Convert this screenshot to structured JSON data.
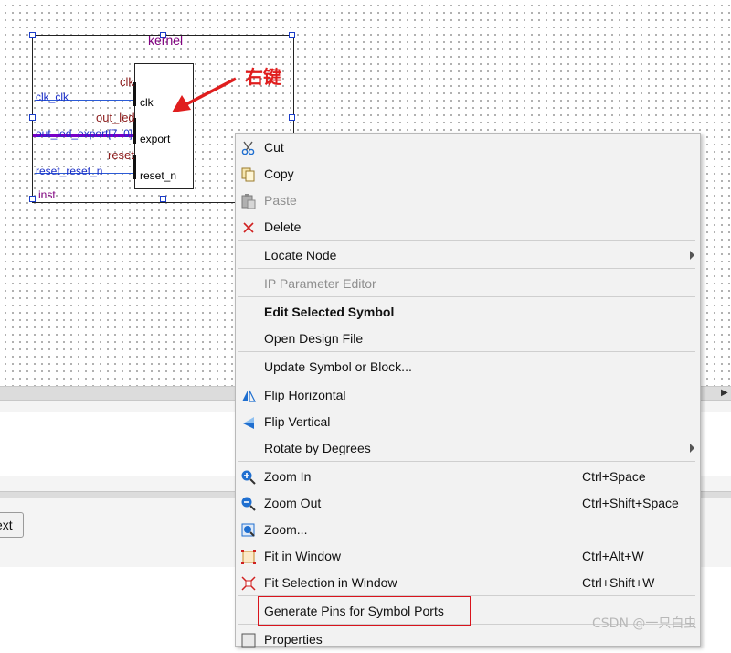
{
  "schematic": {
    "kernel_title": "kernel",
    "instance_name": "inst",
    "ports": {
      "clk": "clk",
      "export": "export",
      "reset_n": "reset_n"
    },
    "interfaces": {
      "clk": "clk",
      "out_led": "out_led",
      "reset": "reset"
    },
    "signals": {
      "clk": "clk_clk",
      "out_led": "out_led_export[7..0]",
      "reset": "reset_reset_n"
    }
  },
  "annotation": {
    "text": "右键",
    "color": "#e01e1e"
  },
  "lower_panel": {
    "button_label": "ext"
  },
  "context_menu": {
    "items": [
      {
        "label": "Cut",
        "shortcut": "",
        "icon": "scissors-icon",
        "disabled": false,
        "bold": false,
        "submenu": false
      },
      {
        "label": "Copy",
        "shortcut": "",
        "icon": "copy-icon",
        "disabled": false,
        "bold": false,
        "submenu": false
      },
      {
        "label": "Paste",
        "shortcut": "",
        "icon": "paste-icon",
        "disabled": true,
        "bold": false,
        "submenu": false
      },
      {
        "label": "Delete",
        "shortcut": "",
        "icon": "delete-x-icon",
        "disabled": false,
        "bold": false,
        "submenu": false
      },
      {
        "label": "Locate Node",
        "shortcut": "",
        "icon": "",
        "disabled": false,
        "bold": false,
        "submenu": true
      },
      {
        "label": "IP Parameter Editor",
        "shortcut": "",
        "icon": "",
        "disabled": true,
        "bold": false,
        "submenu": false
      },
      {
        "label": "Edit Selected Symbol",
        "shortcut": "",
        "icon": "",
        "disabled": false,
        "bold": true,
        "submenu": false
      },
      {
        "label": "Open Design File",
        "shortcut": "",
        "icon": "",
        "disabled": false,
        "bold": false,
        "submenu": false
      },
      {
        "label": "Update Symbol or Block...",
        "shortcut": "",
        "icon": "",
        "disabled": false,
        "bold": false,
        "submenu": false
      },
      {
        "label": "Flip Horizontal",
        "shortcut": "",
        "icon": "flip-horizontal-icon",
        "disabled": false,
        "bold": false,
        "submenu": false
      },
      {
        "label": "Flip Vertical",
        "shortcut": "",
        "icon": "flip-vertical-icon",
        "disabled": false,
        "bold": false,
        "submenu": false
      },
      {
        "label": "Rotate by Degrees",
        "shortcut": "",
        "icon": "",
        "disabled": false,
        "bold": false,
        "submenu": true
      },
      {
        "label": "Zoom In",
        "shortcut": "Ctrl+Space",
        "icon": "zoom-in-icon",
        "disabled": false,
        "bold": false,
        "submenu": false
      },
      {
        "label": "Zoom Out",
        "shortcut": "Ctrl+Shift+Space",
        "icon": "zoom-out-icon",
        "disabled": false,
        "bold": false,
        "submenu": false
      },
      {
        "label": "Zoom...",
        "shortcut": "",
        "icon": "zoom-icon",
        "disabled": false,
        "bold": false,
        "submenu": false
      },
      {
        "label": "Fit in Window",
        "shortcut": "Ctrl+Alt+W",
        "icon": "fit-window-icon",
        "disabled": false,
        "bold": false,
        "submenu": false
      },
      {
        "label": "Fit Selection in Window",
        "shortcut": "Ctrl+Shift+W",
        "icon": "fit-selection-icon",
        "disabled": false,
        "bold": false,
        "submenu": false
      },
      {
        "label": "Generate Pins for Symbol Ports",
        "shortcut": "",
        "icon": "",
        "disabled": false,
        "bold": false,
        "submenu": false
      },
      {
        "label": "Properties",
        "shortcut": "",
        "icon": "properties-icon",
        "disabled": false,
        "bold": false,
        "submenu": false
      }
    ]
  },
  "watermark": "CSDN @一只白虫"
}
